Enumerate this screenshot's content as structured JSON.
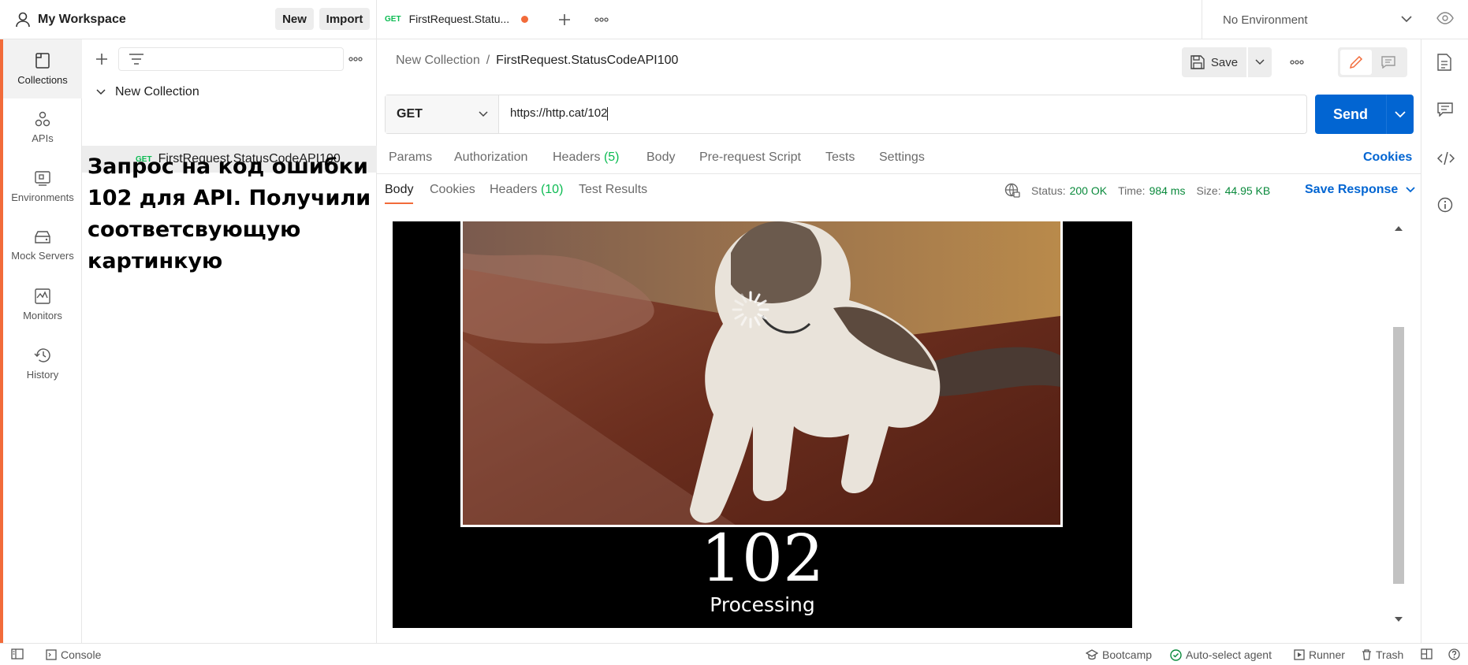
{
  "workspace": {
    "title": "My Workspace",
    "new_label": "New",
    "import_label": "Import"
  },
  "open_tab": {
    "method": "GET",
    "name": "FirstRequest.Statu...",
    "unsaved": true
  },
  "environment": {
    "selected": "No Environment"
  },
  "sidebar": {
    "items": [
      {
        "label": "Collections",
        "icon": "collections-icon",
        "active": true
      },
      {
        "label": "APIs",
        "icon": "apis-icon",
        "active": false
      },
      {
        "label": "Environments",
        "icon": "environments-icon",
        "active": false
      },
      {
        "label": "Mock Servers",
        "icon": "mock-servers-icon",
        "active": false
      },
      {
        "label": "Monitors",
        "icon": "monitors-icon",
        "active": false
      },
      {
        "label": "History",
        "icon": "history-icon",
        "active": false
      }
    ]
  },
  "collections": {
    "collection_name": "New Collection",
    "request": {
      "method": "GET",
      "name": "FirstRequest.StatusCodeAPI100"
    }
  },
  "annotation": "Запрос на код ошибки 102 для API. Получили соответсвующую картинкую",
  "breadcrumb": {
    "parent": "New Collection",
    "separator": "/",
    "current": "FirstRequest.StatusCodeAPI100"
  },
  "toolbar": {
    "save_label": "Save"
  },
  "request": {
    "method": "GET",
    "url": "https://http.cat/102",
    "send_label": "Send"
  },
  "request_tabs": {
    "params": "Params",
    "authorization": "Authorization",
    "headers": "Headers",
    "headers_count": "(5)",
    "body": "Body",
    "prerequest": "Pre-request Script",
    "tests": "Tests",
    "settings": "Settings",
    "cookies": "Cookies"
  },
  "response_tabs": {
    "body": "Body",
    "cookies": "Cookies",
    "headers": "Headers",
    "headers_count": "(10)",
    "test_results": "Test Results"
  },
  "response_meta": {
    "status_label": "Status:",
    "status_value": "200 OK",
    "time_label": "Time:",
    "time_value": "984 ms",
    "size_label": "Size:",
    "size_value": "44.95 KB",
    "save_response": "Save Response"
  },
  "preview": {
    "code": "102",
    "caption": "Processing"
  },
  "footer": {
    "console": "Console",
    "bootcamp": "Bootcamp",
    "agent": "Auto-select agent",
    "runner": "Runner",
    "trash": "Trash"
  },
  "colors": {
    "accent": "#f26b3a",
    "primary": "#0265d2",
    "success": "#0cbb52"
  }
}
